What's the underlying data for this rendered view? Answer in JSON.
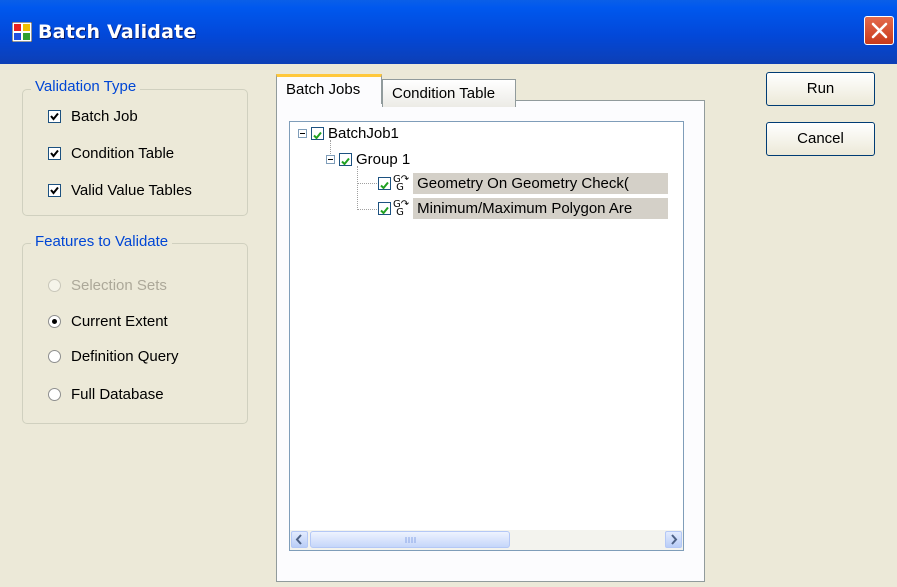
{
  "window": {
    "title": "Batch Validate"
  },
  "validation_type": {
    "label": "Validation Type",
    "items": [
      {
        "label": "Batch Job",
        "checked": true
      },
      {
        "label": "Condition Table",
        "checked": true
      },
      {
        "label": "Valid Value Tables",
        "checked": true
      }
    ]
  },
  "features": {
    "label": "Features to Validate",
    "options": [
      {
        "label": "Selection Sets",
        "selected": false,
        "enabled": false
      },
      {
        "label": "Current Extent",
        "selected": true,
        "enabled": true
      },
      {
        "label": "Definition Query",
        "selected": false,
        "enabled": true
      },
      {
        "label": "Full Database",
        "selected": false,
        "enabled": true
      }
    ]
  },
  "tabs": [
    {
      "label": "Batch Jobs",
      "active": true
    },
    {
      "label": "Condition Table",
      "active": false
    }
  ],
  "tree": {
    "root": {
      "label": "BatchJob1",
      "checked": true
    },
    "group": {
      "label": "Group 1",
      "checked": true
    },
    "checks": [
      {
        "label": "Geometry On Geometry Check(",
        "checked": true
      },
      {
        "label": "Minimum/Maximum Polygon Are",
        "checked": true
      }
    ]
  },
  "buttons": {
    "run": "Run",
    "cancel": "Cancel"
  }
}
